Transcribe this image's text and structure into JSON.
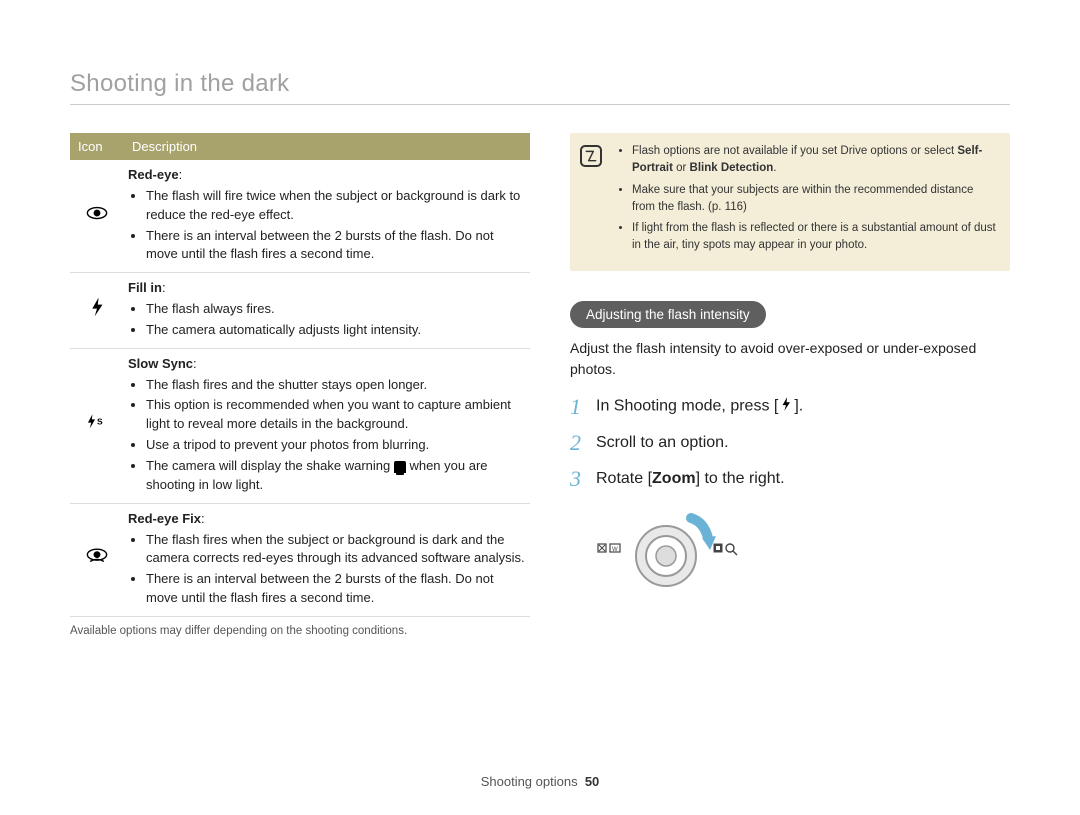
{
  "page_title": "Shooting in the dark",
  "table": {
    "headers": {
      "icon": "Icon",
      "desc": "Description"
    },
    "rows": [
      {
        "icon_name": "red-eye-icon",
        "title": "Red-eye",
        "bullets": [
          "The flash will fire twice when the subject or background is dark to reduce the red-eye effect.",
          "There is an interval between the 2 bursts of the flash. Do not move until the flash fires a second time."
        ]
      },
      {
        "icon_name": "fill-in-icon",
        "title": "Fill in",
        "bullets": [
          "The flash always fires.",
          "The camera automatically adjusts light intensity."
        ]
      },
      {
        "icon_name": "slow-sync-icon",
        "title": "Slow Sync",
        "bullets": [
          "The flash fires and the shutter stays open longer.",
          "This option is recommended when you want to capture ambient light to reveal more details in the background.",
          "Use a tripod to prevent your photos from blurring.",
          "The camera will display the shake warning __HAND__ when you are shooting in low light."
        ]
      },
      {
        "icon_name": "red-eye-fix-icon",
        "title": "Red-eye Fix",
        "bullets": [
          "The flash fires when the subject or background is dark and the camera corrects red-eyes through its advanced software analysis.",
          "There is an interval between the 2 bursts of the flash. Do not move until the flash fires a second time."
        ]
      }
    ]
  },
  "table_footnote": "Available options may differ depending on the shooting conditions.",
  "note_box": {
    "bullets": [
      {
        "pre": "Flash options are not available if you set Drive options or select ",
        "bold1": "Self-Portrait",
        "mid": " or ",
        "bold2": "Blink Detection",
        "post": ".",
        "has_bold": true
      },
      {
        "text": "Make sure that your subjects are within the recommended distance from the flash. (p. 116)"
      },
      {
        "text": "If light from the flash is reflected or there is a substantial amount of dust in the air, tiny spots may appear in your photo."
      }
    ]
  },
  "section": {
    "pill": "Adjusting the flash intensity",
    "intro": "Adjust the flash intensity to avoid over-exposed or under-exposed photos.",
    "steps": [
      {
        "num": "1",
        "pre": "In Shooting mode, press [",
        "icon": "flash-button-icon",
        "post": "]."
      },
      {
        "num": "2",
        "text": "Scroll to an option."
      },
      {
        "num": "3",
        "pre": "Rotate [",
        "bold": "Zoom",
        "post": "] to the right."
      }
    ]
  },
  "footer": {
    "label": "Shooting options",
    "page": "50"
  }
}
